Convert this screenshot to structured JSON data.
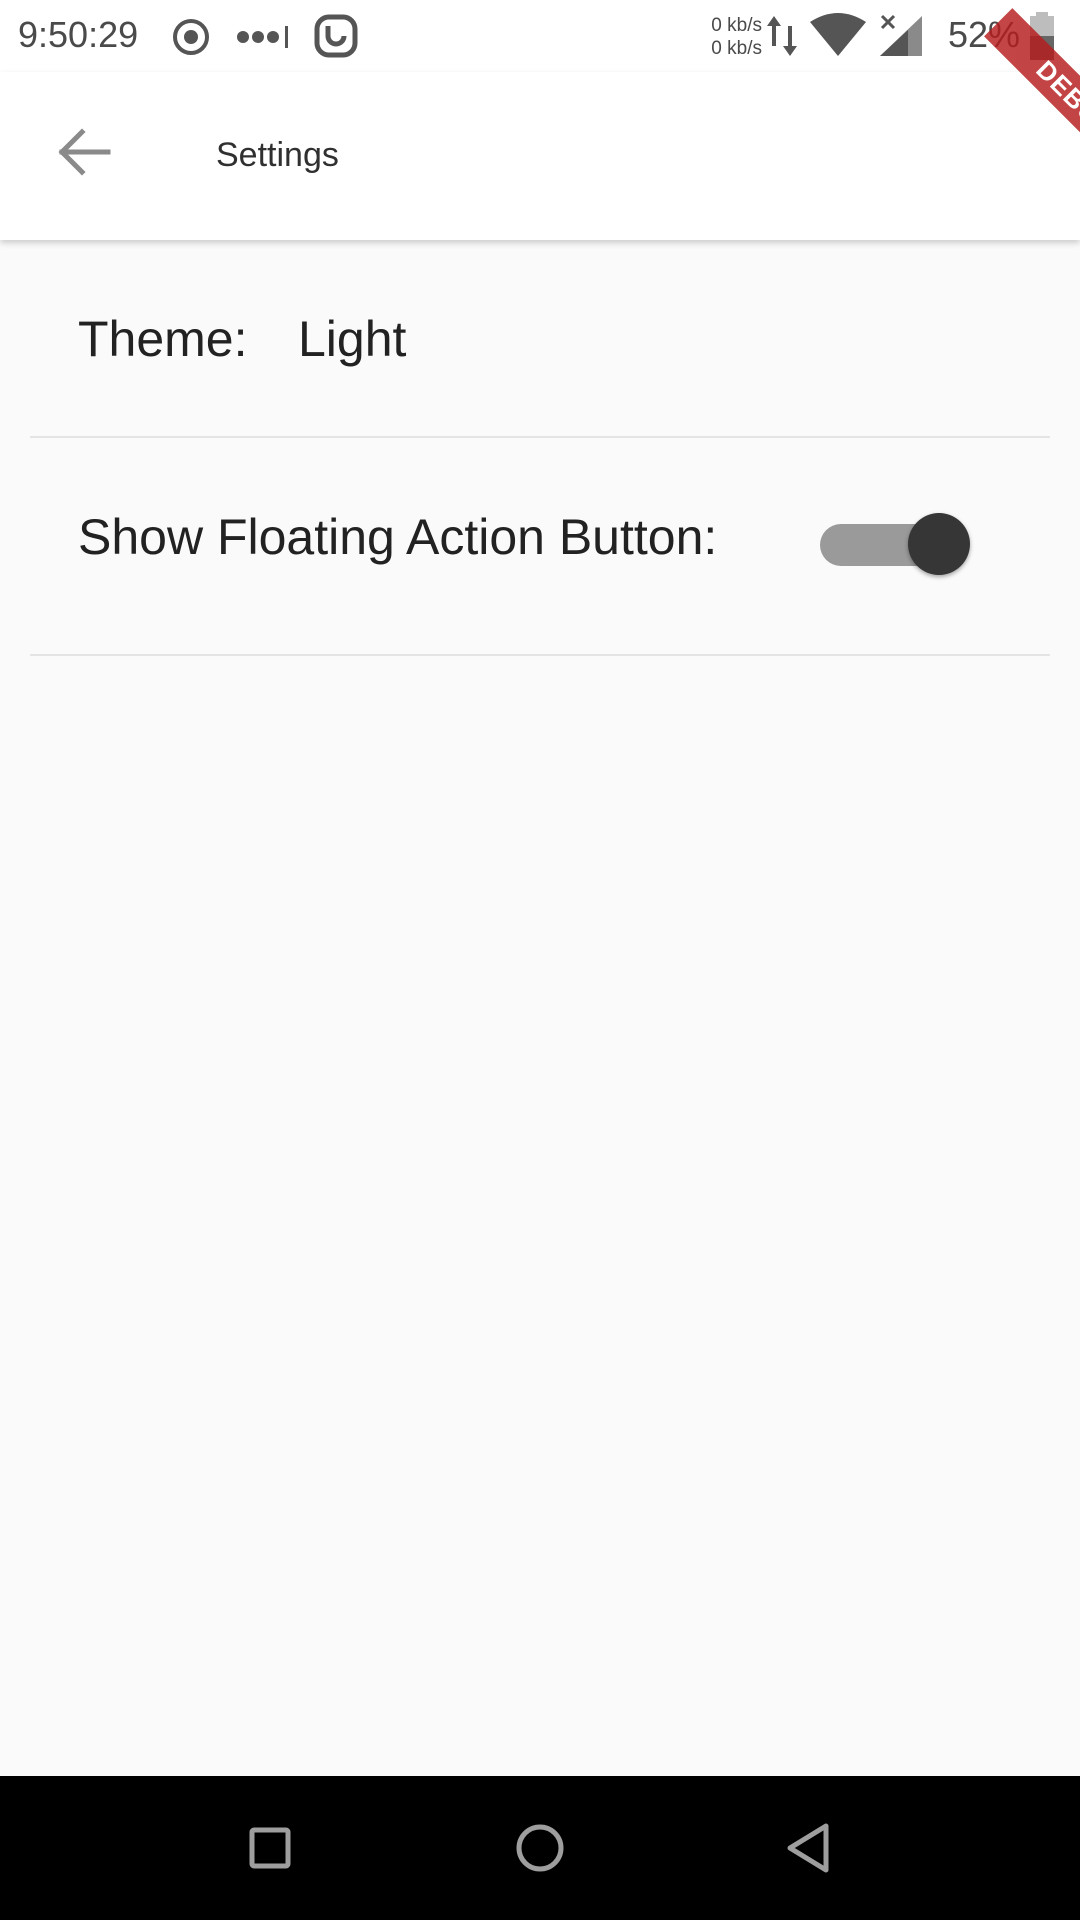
{
  "status_bar": {
    "time": "9:50:29",
    "rate_up": "0 kb/s",
    "rate_down": "0 kb/s",
    "battery_percent": "52%",
    "icons": [
      "record-icon",
      "more-dots-icon",
      "magnet-icon",
      "data-transfer-icon",
      "wifi-icon",
      "signal-icon",
      "battery-icon"
    ]
  },
  "app_bar": {
    "title": "Settings",
    "back_icon": "arrow-back-icon"
  },
  "debug_banner": {
    "text": "DEBUG",
    "color": "#b71c1c"
  },
  "settings": {
    "theme_label": "Theme:",
    "theme_value": "Light",
    "fab_label": "Show Floating Action Button:",
    "fab_enabled": true
  },
  "nav_bar": {
    "buttons": [
      "recents-icon",
      "home-icon",
      "back-icon"
    ]
  }
}
